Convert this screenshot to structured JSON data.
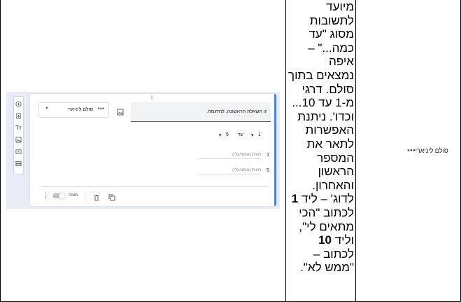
{
  "screenshot": {
    "question_placeholder": "זו השאלה הראשונה, להדגמה.",
    "type_select_label": "סולם ליניארי",
    "scale_from": "1",
    "scale_to_word": "עד",
    "scale_to": "5",
    "option_min_number": "1",
    "option_min_placeholder": "תווית (אופציונלי)",
    "option_max_number": "5",
    "option_max_placeholder": "תווית (אופציונלי)",
    "required_label": "חובה",
    "drag_handle": "⠿"
  },
  "description": {
    "part1": "מיועד לתשובות מסוג \"עד כמה...\" – איפה נמצאים בתוך סולם. דרגי מ-1 עד 10... וכדו'. ניתנת האפשרות לתאר את המספר הראשון והאחרון. לדוג' – ליד ",
    "bold1": "1",
    "part2": " לכתוב \"הכי מתאים לי\", וליד ",
    "bold2": "10",
    "part3": " לכתוב – \"ממש לא\"."
  },
  "row_label": "סולם ליניארי",
  "icons": [
    "add-circle-icon",
    "import-icon",
    "title-icon",
    "image-icon",
    "video-icon",
    "section-icon",
    "image-icon",
    "dots-icon",
    "dropdown-arrow-icon",
    "copy-icon",
    "trash-icon",
    "more-vert-icon"
  ]
}
